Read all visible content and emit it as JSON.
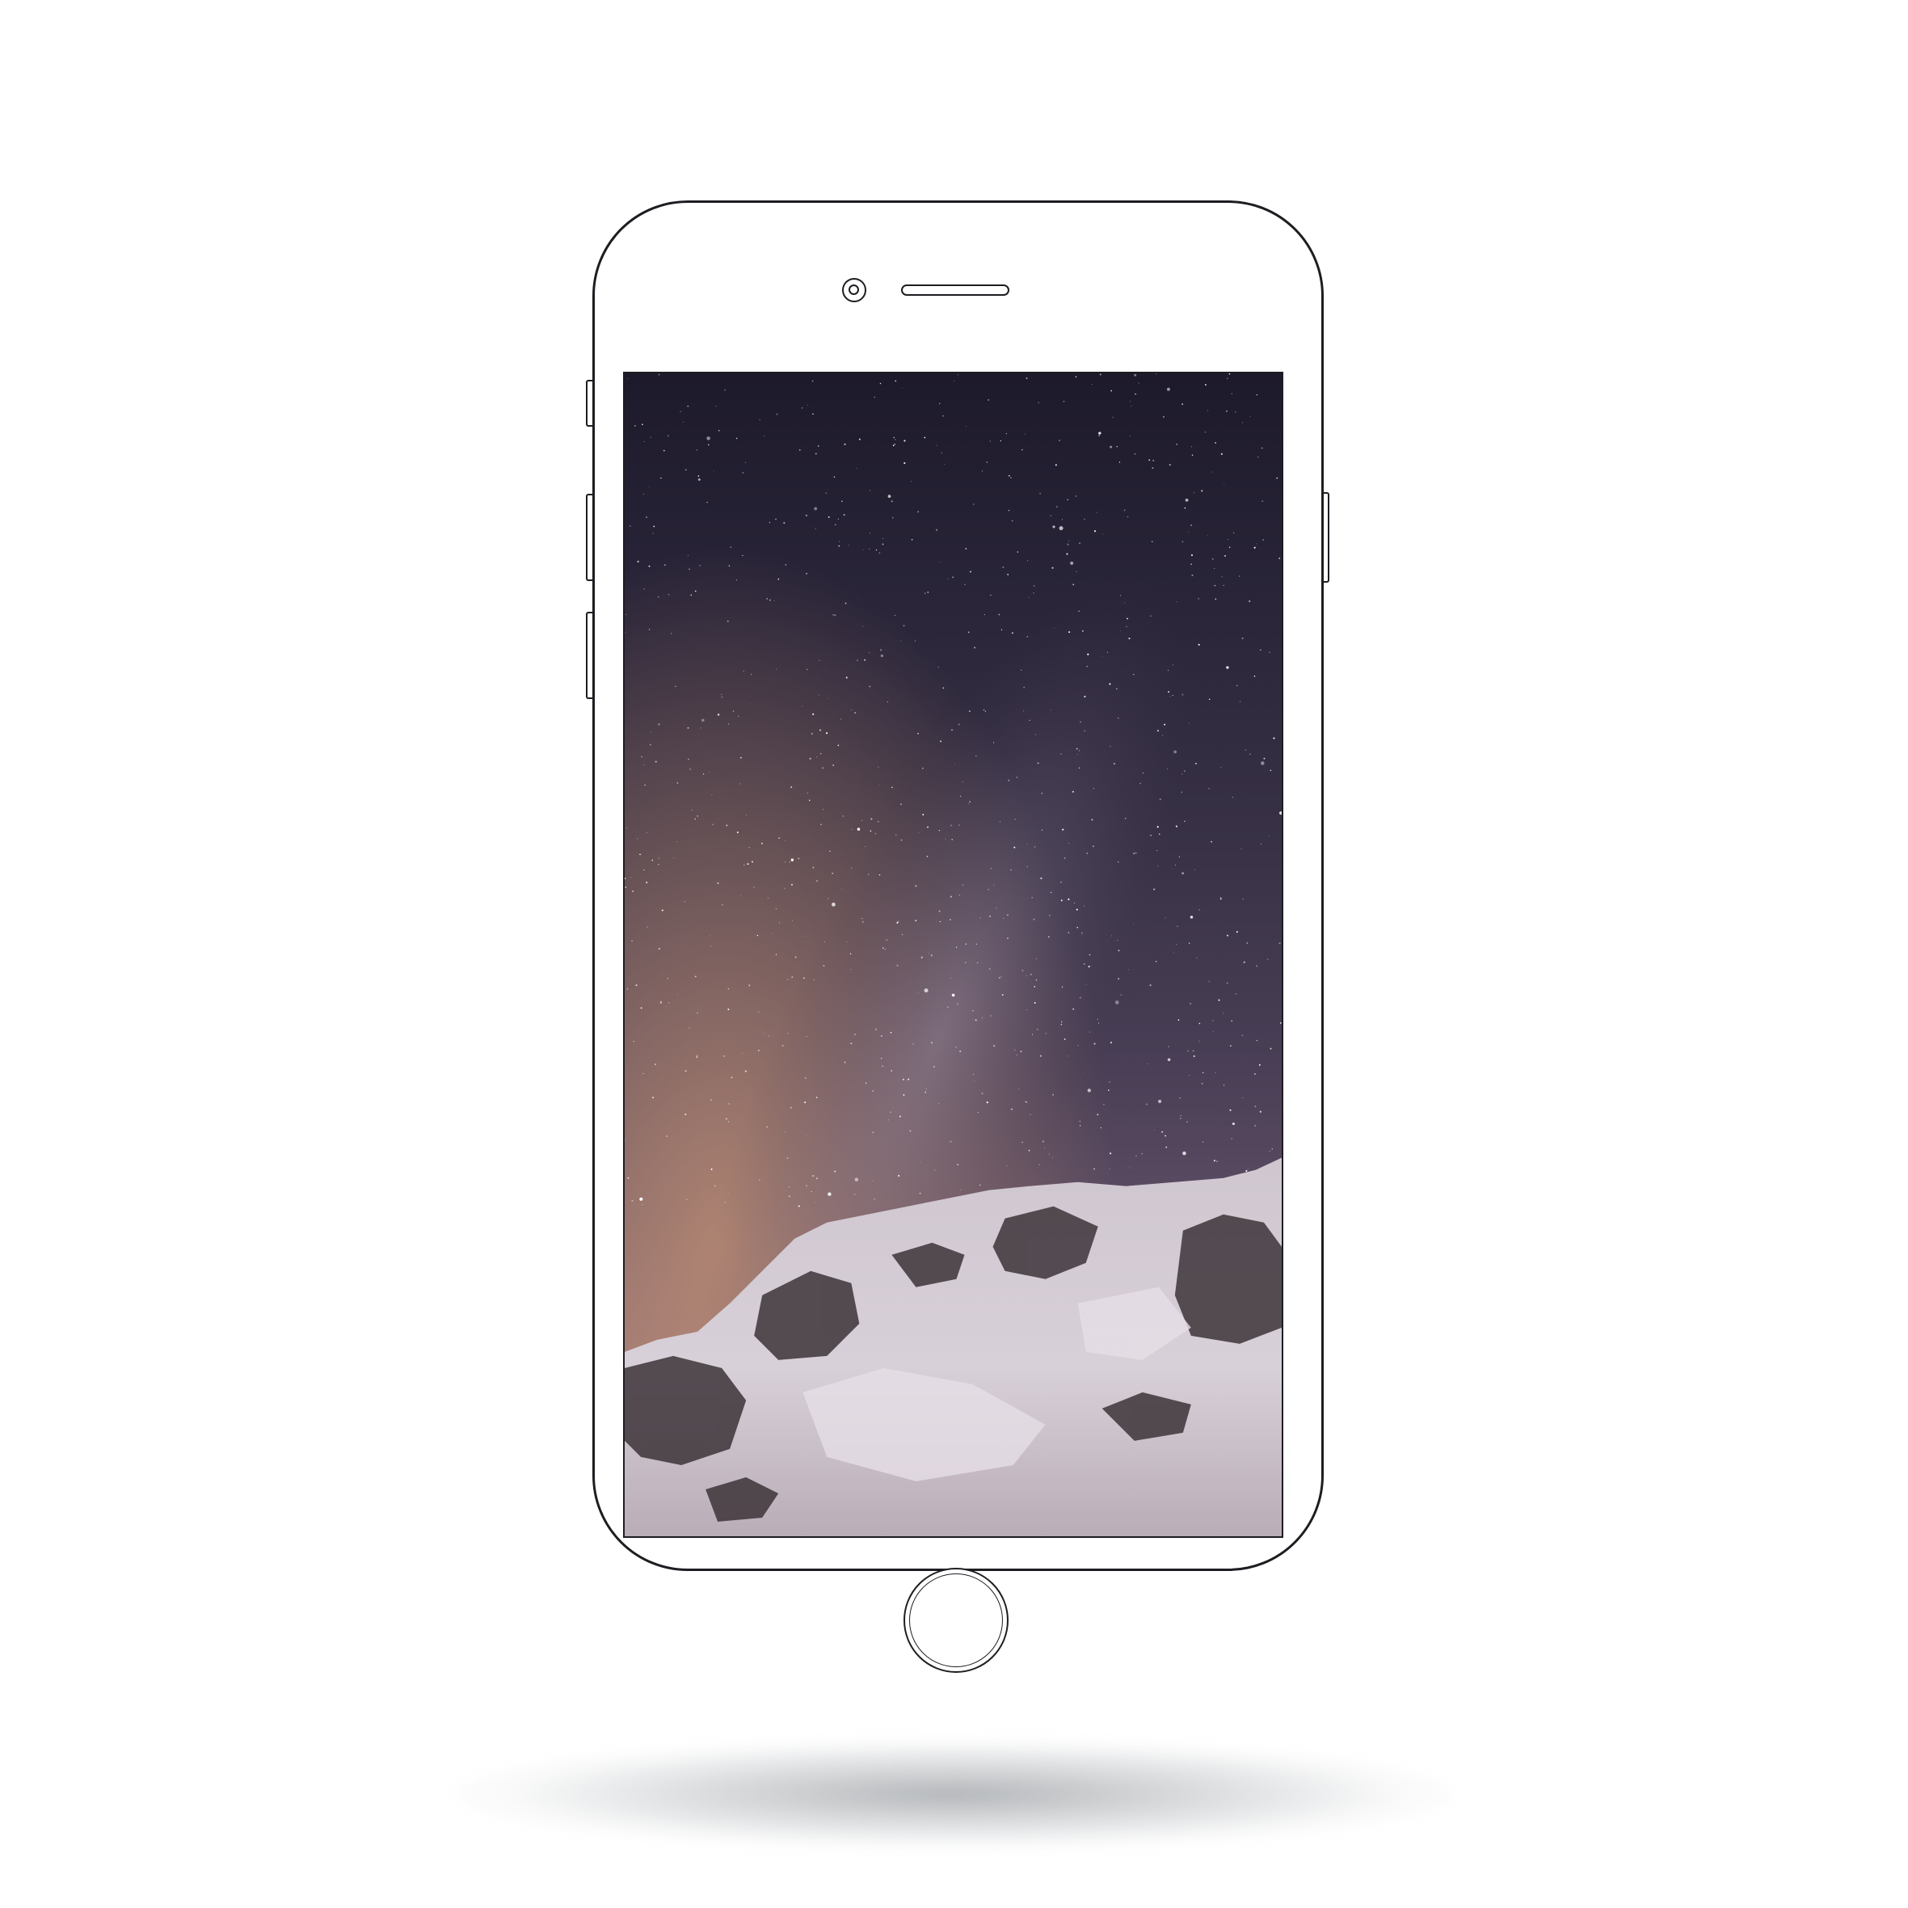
{
  "device": {
    "model": "phone",
    "color": "#ffffff",
    "outline_color": "#1d1d22"
  },
  "screen": {
    "state": "wallpaper",
    "wallpaper": "starry-night-sky-over-snowy-mountain",
    "colors": {
      "sky_top": "#1d1a2b",
      "sky_mid": "#4a3f56",
      "horizon_glow": "#b48872",
      "snow": "#d9d3da",
      "rock": "#3a3236"
    }
  },
  "icons": {
    "front_camera": "front-camera-icon",
    "earpiece": "speaker-grille-icon",
    "home": "home-button-icon"
  }
}
